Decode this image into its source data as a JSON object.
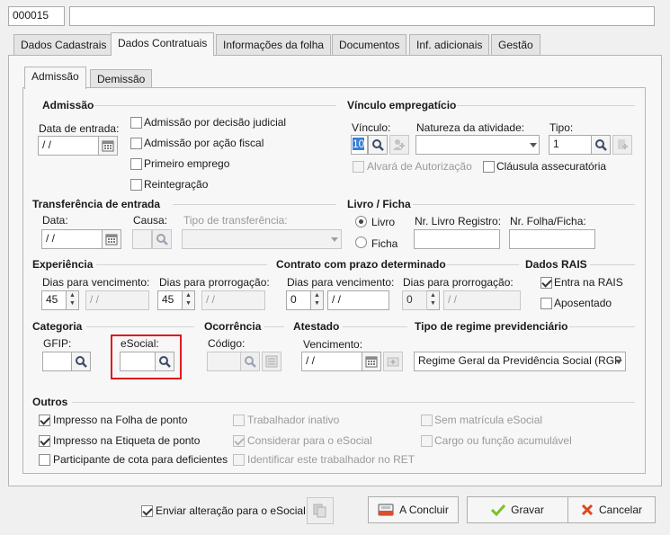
{
  "header": {
    "code_value": "000015",
    "name_value": ""
  },
  "tabs": [
    "Dados Cadastrais",
    "Dados Contratuais",
    "Informações da folha",
    "Documentos",
    "Inf. adicionais",
    "Gestão"
  ],
  "subtabs": [
    "Admissão",
    "Demissão"
  ],
  "admissao": {
    "title": "Admissão",
    "data_entrada_label": "Data de entrada:",
    "data_entrada_value": " / /",
    "checks": [
      "Admissão por decisão judicial",
      "Admissão por ação fiscal",
      "Primeiro emprego",
      "Reintegração"
    ]
  },
  "vinculo": {
    "title": "Vínculo empregatício",
    "vinculo_label": "Vínculo:",
    "vinculo_value": "10",
    "natureza_label": "Natureza da atividade:",
    "natureza_value": "",
    "tipo_label": "Tipo:",
    "tipo_value": "1",
    "alvara_label": "Alvará de Autorização",
    "clausula_label": "Cláusula assecuratória"
  },
  "transferencia": {
    "title": "Transferência de entrada",
    "data_label": "Data:",
    "data_value": " / /",
    "causa_label": "Causa:",
    "tipo_label": "Tipo de transferência:"
  },
  "livro": {
    "title": "Livro / Ficha",
    "livro_label": "Livro",
    "ficha_label": "Ficha",
    "nr_livro_label": "Nr. Livro Registro:",
    "nr_folha_label": "Nr. Folha/Ficha:"
  },
  "experiencia": {
    "title": "Experiência",
    "dias_venc_label": "Dias para vencimento:",
    "dias_venc_value": "45",
    "date1": " / /",
    "dias_prorr_label": "Dias para prorrogação:",
    "dias_prorr_value": "45",
    "date2": " / /"
  },
  "contrato": {
    "title": "Contrato com prazo determinado",
    "dias_venc_label": "Dias para vencimento:",
    "dias_venc_value": "0",
    "date1": " / /",
    "dias_prorr_label": "Dias para prorrogação:",
    "dias_prorr_value": "0",
    "date2": " / /"
  },
  "rais": {
    "title": "Dados RAIS",
    "entra_label": "Entra na RAIS",
    "aposentado_label": "Aposentado"
  },
  "categoria": {
    "title": "Categoria",
    "gfip_label": "GFIP:",
    "esocial_label": "eSocial:"
  },
  "ocorrencia": {
    "title": "Ocorrência",
    "codigo_label": "Código:"
  },
  "atestado": {
    "title": "Atestado",
    "vencimento_label": "Vencimento:",
    "vencimento_value": " / /"
  },
  "regime": {
    "title": "Tipo de regime previdenciário",
    "value": "Regime Geral da Previdência Social (RGP"
  },
  "outros": {
    "title": "Outros",
    "col1": [
      "Impresso na Folha de ponto",
      "Impresso na Etiqueta de ponto",
      "Participante de cota para deficientes"
    ],
    "col2": [
      "Trabalhador inativo",
      "Considerar para o eSocial",
      "Identificar este trabalhador no RET"
    ],
    "col3": [
      "Sem matrícula eSocial",
      "Cargo ou função acumulável"
    ]
  },
  "footer": {
    "enviar_label": "Enviar alteração para o eSocial",
    "concluir_label": "A Concluir",
    "gravar_label": "Gravar",
    "cancelar_label": "Cancelar"
  },
  "colors": {
    "highlight_box": "#e0191c",
    "selection": "#3a7fd5"
  }
}
